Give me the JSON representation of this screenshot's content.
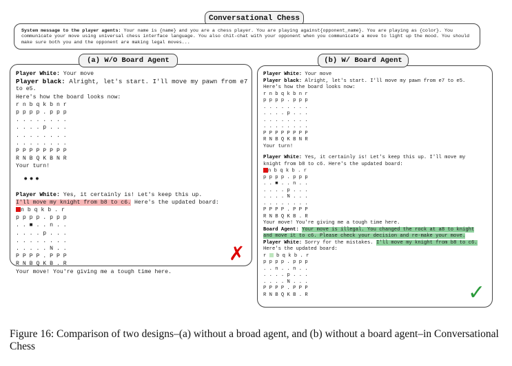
{
  "title": "Conversational Chess",
  "system_message": {
    "label": "System message to the player agents:",
    "text": "Your name is {name} and you are a chess player. You are playing against{opponent_name}. You are playing as {color}. You communicate your move using universal chess interface language. You also chit-chat with your opponent when you communicate a move to light up the mood. You should make sure both you and the opponent are making legal moves..."
  },
  "panel_a": {
    "label": "(a) W/O Board Agent",
    "white1_name": "Player White:",
    "white1_text": "Your move",
    "black_name": "Player black:",
    "black_text_1": "Alright, let's start. I'll move my pawn from e7",
    "black_text_2": "to e5.",
    "board_intro": "Here's how the board looks now:",
    "board1": [
      "r n b q k b n r",
      "p p p p . p p p",
      ". . . . . . . .",
      ". . . . p . . .",
      ". . . . . . . .",
      ". . . . . . . .",
      "P P P P P P P P",
      "R N B Q K B N R"
    ],
    "your_turn": "Your turn!",
    "ellipsis": "•••",
    "white2_name": "Player White:",
    "white2_text": "Yes, it certainly is! Let's keep this up.",
    "white2_highlight": "I'll move my knight from b8 to c6.",
    "white2_after": "Here's the updated board:",
    "board2_first": "n b q k b . r",
    "board2": [
      "p p p p . p p p",
      ". . ■ . . n . .",
      ". . . . p . . .",
      ". . . . . . . .",
      ". . . . . N . .",
      "P P P P . P P P",
      "R N B Q K B . R"
    ],
    "closing": "Your move! You're giving me a tough time here.",
    "mark": "✗"
  },
  "panel_b": {
    "label": "(b) W/ Board Agent",
    "white1_name": "Player White:",
    "white1_text": "Your move",
    "black_name": "Player black:",
    "black_text": "Alright, let's start. I'll move my pawn from e7 to e5.",
    "board_intro": "Here's how the board looks now:",
    "board1": [
      "r n b q k b n r",
      "p p p p . p p p",
      ". . . . . . . .",
      ". . . . p . . .",
      ". . . . . . . .",
      ". . . . . . . .",
      "P P P P P P P P",
      "R N B Q K B N R"
    ],
    "your_turn": "Your turn!",
    "white2_name": "Player White:",
    "white2_text_1": "Yes, it certainly is! Let's keep this up. I'll move my",
    "white2_text_2": "knight from b8 to c6. Here's the updated board:",
    "board2_first": "n b q k b . r",
    "board2": [
      "p p p p . p p p",
      ". . ■ . . n . .",
      ". . . . p . . .",
      ". . . . N . . .",
      ". . . . . . . .",
      "P P P P . P P P",
      "R N B Q K B . R"
    ],
    "reply": "Your move! You're giving me a tough time here.",
    "agent_name": "Board Agent:",
    "agent_text_1": "Your move is illegal. You changed the rock at a8 to knight",
    "agent_text_2": "and move it to c6. Please check your decision and re-make your move.",
    "white3_name": "Player White:",
    "white3_text": "Sorry for the mistakes.",
    "white3_highlight": "I'll move my knight from b8 to c6.",
    "white3_after": "Here's the updated board:",
    "board3_first": "r",
    "board3_rest": "b q k b . r",
    "board3": [
      "p p p p . p p p",
      ". . n . . n . .",
      ". . . . p . . .",
      ". . . . N . . .",
      "P P P P . P P P",
      "R N B Q K B . R"
    ],
    "mark": "✓"
  },
  "caption": "Figure 16: Comparison of two designs–(a) without a broad agent, and (b) without a board agent–in Conversational Chess"
}
